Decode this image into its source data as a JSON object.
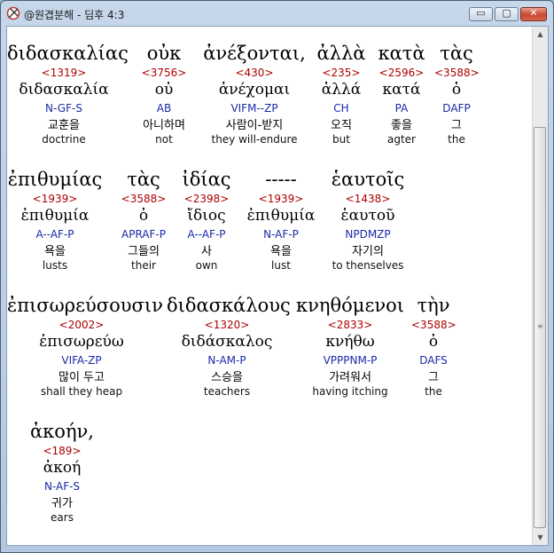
{
  "window": {
    "title": "@원겹분해 - 딤후 4:3",
    "icon": "app-logo-icon",
    "controls": {
      "minimize": "▭",
      "maximize": "▢",
      "close": "✕"
    }
  },
  "rows": [
    {
      "words": [
        {
          "greek": "διδασκαλίας",
          "strong": "<1319>",
          "lemma": "διδασκαλία",
          "morph": "N-GF-S",
          "korean": "교훈을",
          "english": "doctrine"
        },
        {
          "greek": "οὐκ",
          "strong": "<3756>",
          "lemma": "οὐ",
          "morph": "AB",
          "korean": "아니하며",
          "english": "not"
        },
        {
          "greek": "ἀνέξονται,",
          "strong": "<430>",
          "lemma": "ἀνέχομαι",
          "morph": "VIFM--ZP",
          "korean": "사람이-받지",
          "english": "they will-endure"
        },
        {
          "greek": "ἀλλὰ",
          "strong": "<235>",
          "lemma": "ἀλλά",
          "morph": "CH",
          "korean": "오직",
          "english": "but"
        },
        {
          "greek": "κατὰ",
          "strong": "<2596>",
          "lemma": "κατά",
          "morph": "PA",
          "korean": "좋을",
          "english": "agter"
        },
        {
          "greek": "τὰς",
          "strong": "<3588>",
          "lemma": "ὁ",
          "morph": "DAFP",
          "korean": "그",
          "english": "the"
        }
      ]
    },
    {
      "words": [
        {
          "greek": "ἐπιθυμίας",
          "strong": "<1939>",
          "lemma": "ἐπιθυμία",
          "morph": "A--AF-P",
          "korean": "욕을",
          "english": "lusts"
        },
        {
          "greek": "τὰς",
          "strong": "<3588>",
          "lemma": "ὁ",
          "morph": "APRAF-P",
          "korean": "그들의",
          "english": "their"
        },
        {
          "greek": "ἰδίας",
          "strong": "<2398>",
          "lemma": "ἴδιος",
          "morph": "A--AF-P",
          "korean": "사",
          "english": "own"
        },
        {
          "greek": "-----",
          "strong": "<1939>",
          "lemma": "ἐπιθυμία",
          "morph": "N-AF-P",
          "korean": "욕을",
          "english": "lust"
        },
        {
          "greek": "ἑαυτοῖς",
          "strong": "<1438>",
          "lemma": "ἑαυτοῦ",
          "morph": "NPDMZP",
          "korean": "자기의",
          "english": "to thenselves"
        }
      ]
    },
    {
      "words": [
        {
          "greek": "ἐπισωρεύσουσιν",
          "strong": "<2002>",
          "lemma": "ἐπισωρεύω",
          "morph": "VIFA-ZP",
          "korean": "많이 두고",
          "english": "shall they heap"
        },
        {
          "greek": "διδασκάλους",
          "strong": "<1320>",
          "lemma": "διδάσκαλος",
          "morph": "N-AM-P",
          "korean": "스승을",
          "english": "teachers"
        },
        {
          "greek": "κνηθόμενοι",
          "strong": "<2833>",
          "lemma": "κνήθω",
          "morph": "VPPPNM-P",
          "korean": "가려워서",
          "english": "having itching"
        },
        {
          "greek": "τὴν",
          "strong": "<3588>",
          "lemma": "ὁ",
          "morph": "DAFS",
          "korean": "그",
          "english": "the"
        }
      ]
    },
    {
      "words": [
        {
          "greek": "ἀκοήν,",
          "strong": "<189>",
          "lemma": "ἀκοή",
          "morph": "N-AF-S",
          "korean": "귀가",
          "english": "ears"
        }
      ]
    }
  ],
  "scrollbar": {
    "up": "▲",
    "down": "▼",
    "grip": "≡"
  }
}
